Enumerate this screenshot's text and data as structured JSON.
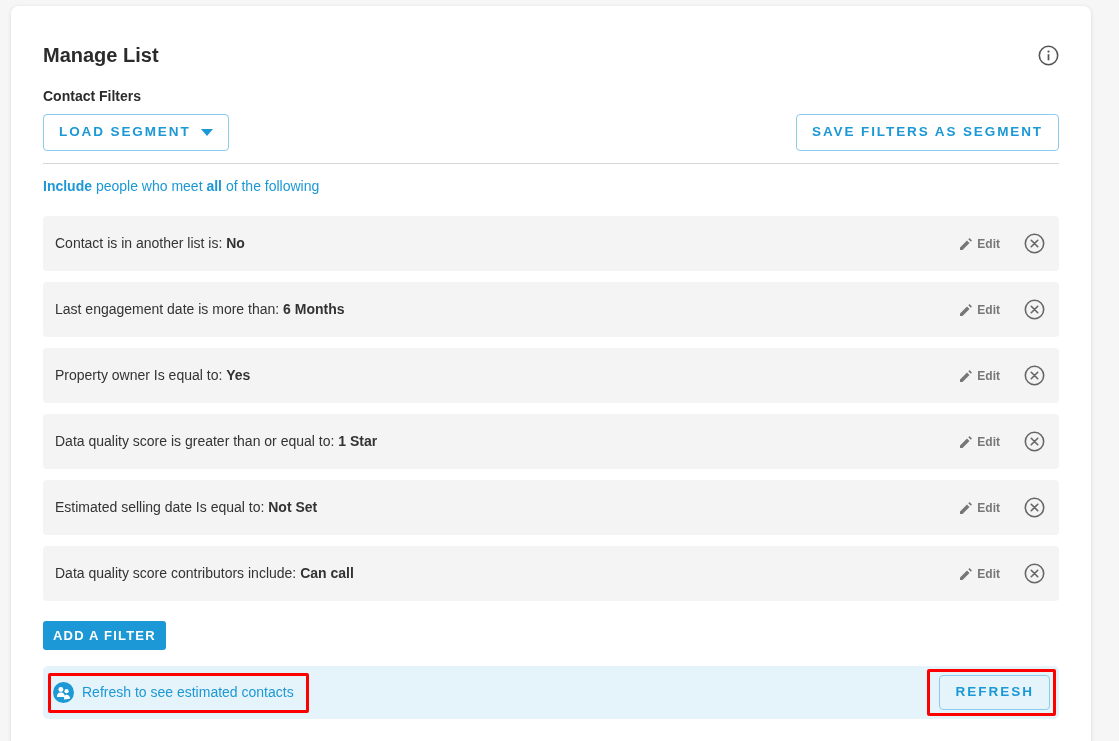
{
  "header": {
    "title": "Manage List"
  },
  "section_label": "Contact Filters",
  "toolbar": {
    "load_segment": {
      "label": "LOAD SEGMENT"
    },
    "save_segment": {
      "label": "SAVE FILTERS AS SEGMENT"
    }
  },
  "rule_summary": "**Include** people who meet **all** of the following",
  "filters": [
    {
      "text": "Contact is in another list is: **No**",
      "edit_label": "Edit"
    },
    {
      "text": "Last engagement date is more than: **6 Months**",
      "edit_label": "Edit"
    },
    {
      "text": "Property owner Is equal to: **Yes**",
      "edit_label": "Edit"
    },
    {
      "text": "Data quality score is greater than or equal to: **1 Star**",
      "edit_label": "Edit"
    },
    {
      "text": "Estimated selling date Is equal to: **Not Set**",
      "edit_label": "Edit"
    },
    {
      "text": "Data quality score contributors include: **Can call**",
      "edit_label": "Edit"
    }
  ],
  "add_filter": {
    "label": "ADD A FILTER"
  },
  "estimate": {
    "message": "Refresh to see estimated contacts",
    "highlighted": true,
    "refresh": {
      "label": "REFRESH",
      "highlighted": true
    }
  }
}
